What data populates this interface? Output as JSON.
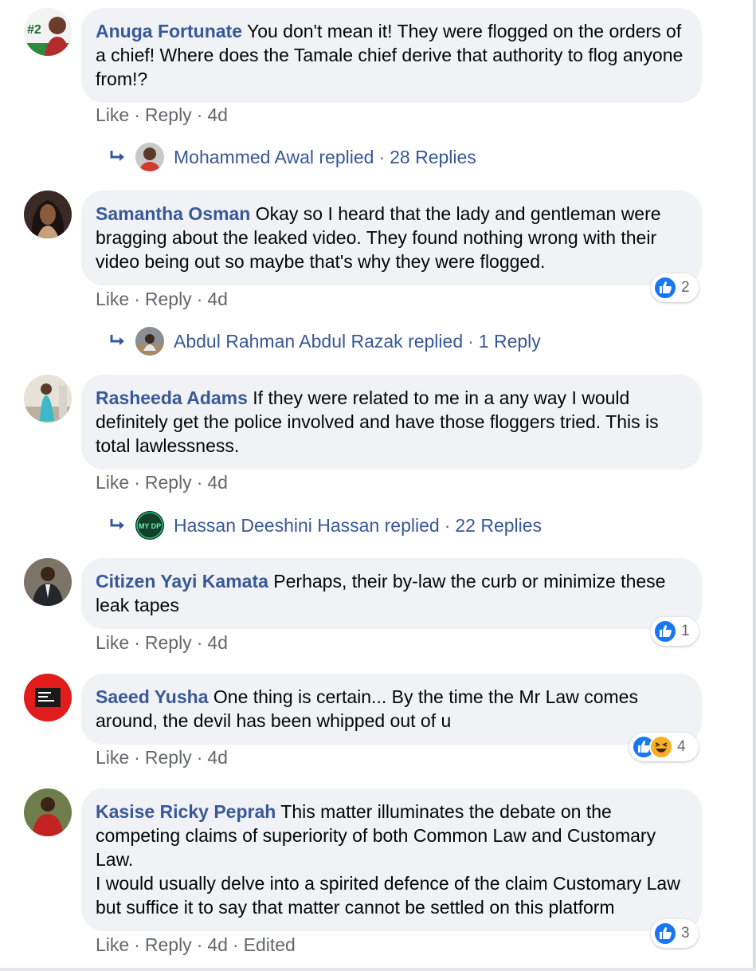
{
  "actions": {
    "like": "Like",
    "reply": "Reply",
    "dot": "·",
    "edited": "Edited"
  },
  "colors": {
    "author": "#385898",
    "meta": "#65676b",
    "bubble": "#f0f2f5",
    "like_blue": "#1877f2"
  },
  "comments": [
    {
      "author": "Anuga Fortunate",
      "text": "You don't mean it! They were flogged on the orders of a chief! Where does the Tamale chief derive that authority to flog anyone from!?",
      "time": "4d",
      "avatar_badge": "#2",
      "reply_summary": {
        "name": "Mohammed Awal replied",
        "count": "28 Replies"
      }
    },
    {
      "author": "Samantha Osman",
      "text": "Okay so I heard that the lady and gentleman were bragging about the leaked video. They found nothing wrong with their video being out so maybe that's why they were flogged.",
      "time": "4d",
      "reactions": {
        "icons": [
          "like-icon"
        ],
        "count": "2"
      },
      "reply_summary": {
        "name": "Abdul Rahman Abdul Razak replied",
        "count": "1 Reply"
      }
    },
    {
      "author": "Rasheeda Adams",
      "text": "If they were related to me in a any way I would definitely get the police involved and have those floggers tried. This is total lawlessness.",
      "time": "4d",
      "reply_summary": {
        "name": "Hassan Deeshini Hassan replied",
        "count": "22 Replies",
        "avatar_text": "MY DP"
      }
    },
    {
      "author": "Citizen Yayi Kamata",
      "text": "Perhaps, their by-law the curb or minimize these leak tapes",
      "time": "4d",
      "reactions": {
        "icons": [
          "like-icon"
        ],
        "count": "1"
      }
    },
    {
      "author": "Saeed Yusha",
      "text": "One thing is certain... By the time the Mr Law comes around, the devil has been whipped out of u",
      "time": "4d",
      "reactions": {
        "icons": [
          "like-icon",
          "haha-icon"
        ],
        "count": "4"
      }
    },
    {
      "author": "Kasise Ricky Peprah",
      "text": "This matter illuminates the debate on the competing claims of superiority of both Common Law and Customary Law.",
      "text2": "I would usually delve into a spirited defence of the claim Customary Law but suffice it to say that matter cannot be settled on this platform",
      "time": "4d",
      "edited": true,
      "reactions": {
        "icons": [
          "like-icon"
        ],
        "count": "3"
      }
    }
  ]
}
